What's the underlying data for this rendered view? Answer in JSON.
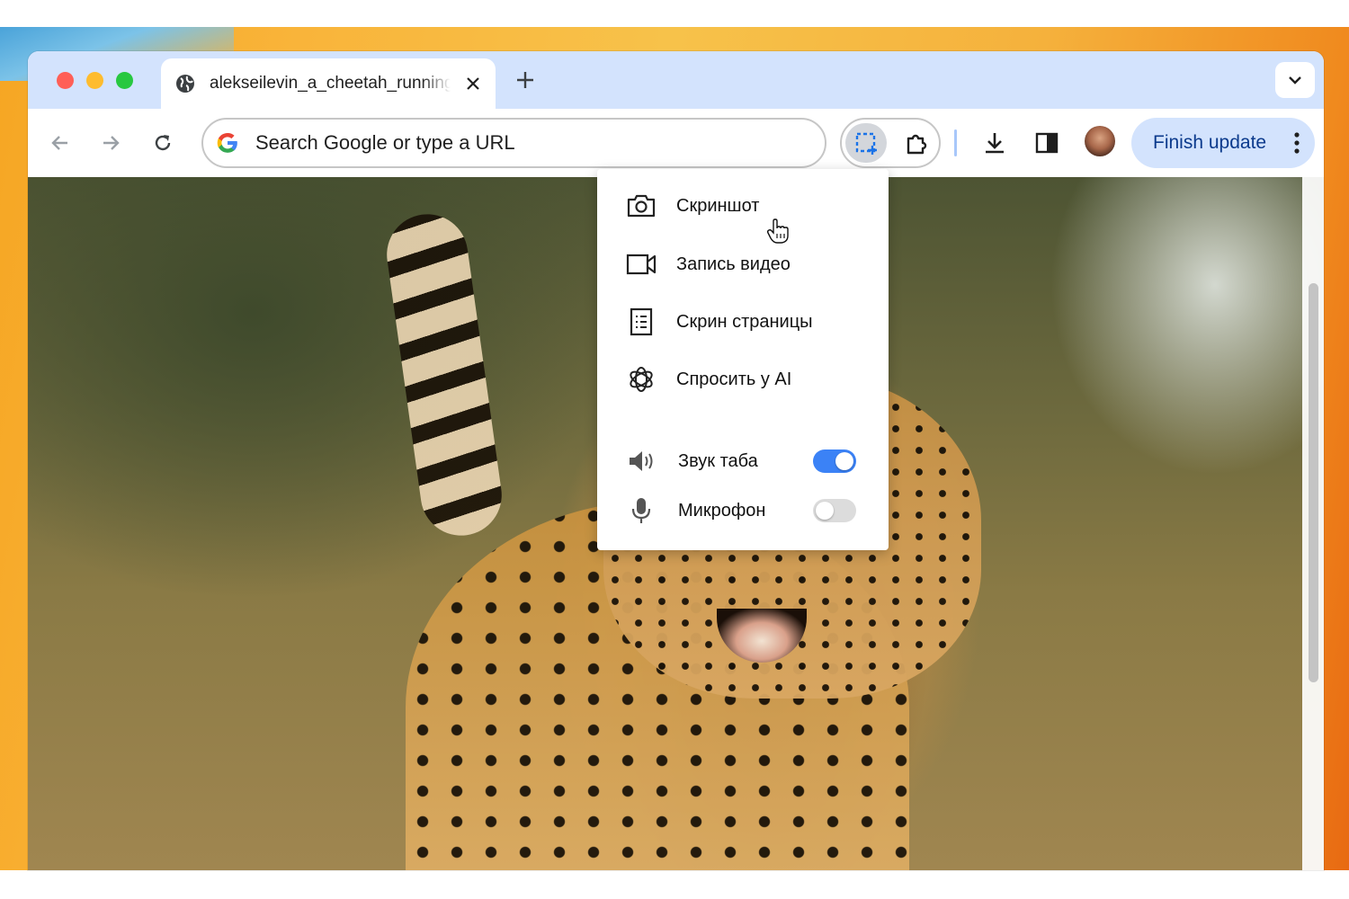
{
  "tab": {
    "title": "alekseilevin_a_cheetah_running"
  },
  "omnibox": {
    "placeholder": "Search Google or type a URL"
  },
  "toolbar": {
    "finish_update_label": "Finish update"
  },
  "menu": {
    "items": [
      {
        "label": "Скриншот",
        "icon": "camera-icon"
      },
      {
        "label": "Запись видео",
        "icon": "video-camera-icon"
      },
      {
        "label": "Скрин страницы",
        "icon": "page-document-icon"
      },
      {
        "label": "Спросить у AI",
        "icon": "openai-logo-icon"
      }
    ],
    "toggles": [
      {
        "label": "Звук таба",
        "icon": "speaker-icon",
        "on": true
      },
      {
        "label": "Микрофон",
        "icon": "microphone-icon",
        "on": false
      }
    ]
  },
  "colors": {
    "tabstrip": "#d3e3fd",
    "accent_blue": "#3b82f6",
    "finish_update_bg": "#d3e3fd"
  }
}
